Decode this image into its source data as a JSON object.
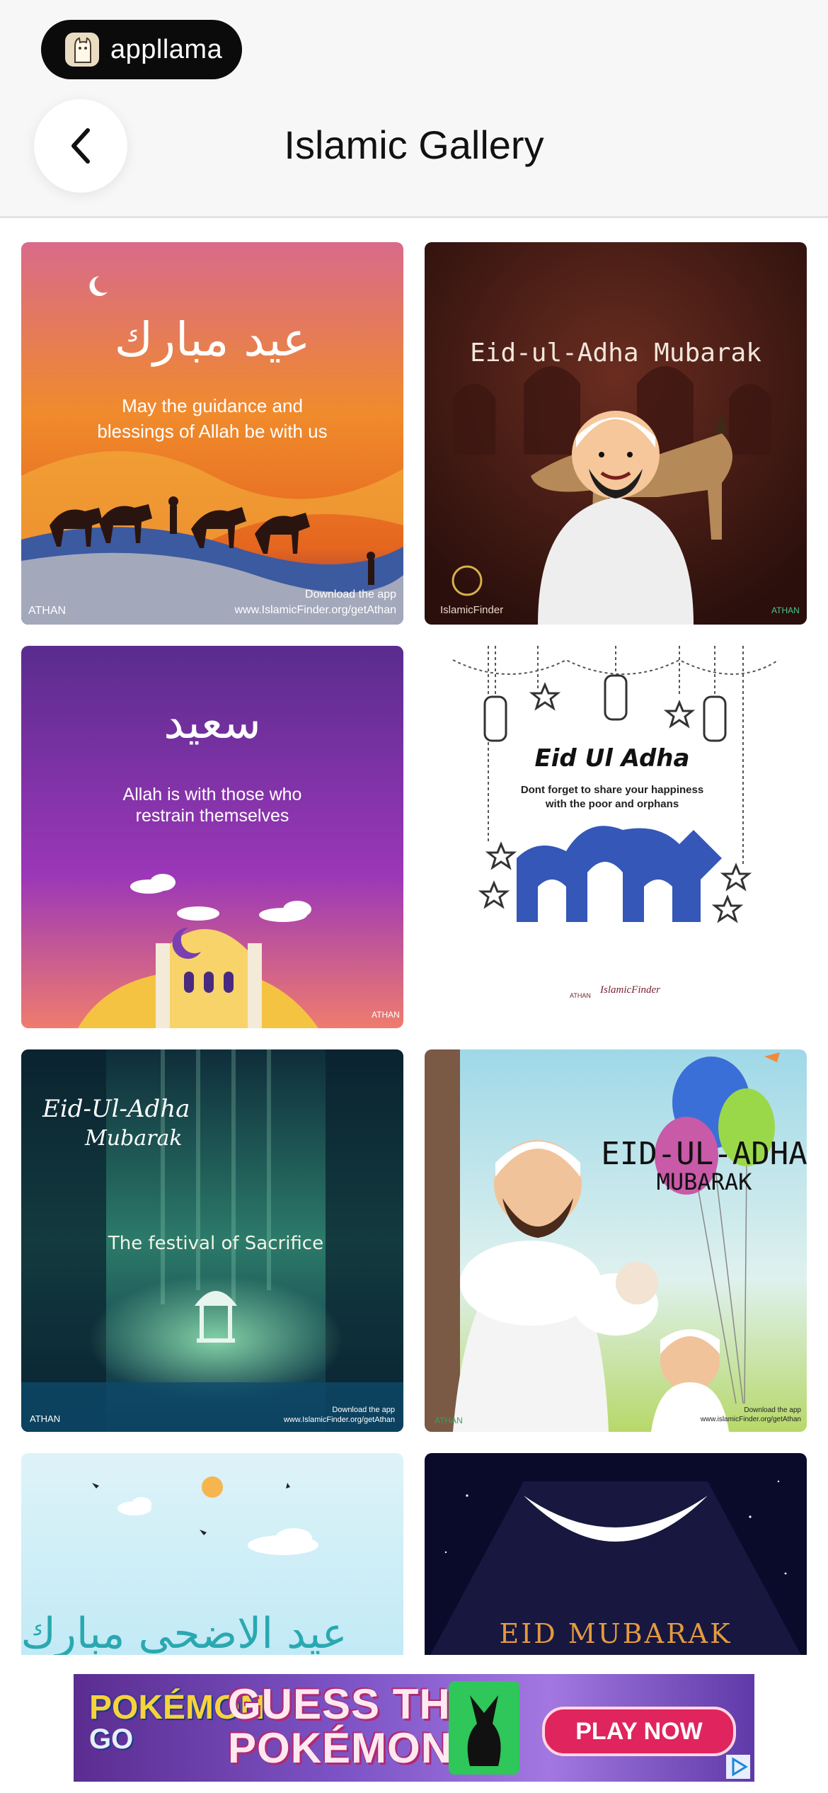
{
  "brand": {
    "name": "appllama"
  },
  "header": {
    "title": "Islamic Gallery",
    "back_icon": "chevron-left-icon"
  },
  "tiles": [
    {
      "lines": [
        "عيد مبارك",
        "May the guidance and",
        "blessings of Allah be with us"
      ],
      "footer_brand": "ATHAN",
      "footer_lines": [
        "Download the app",
        "www.IslamicFinder.org/getAthan"
      ]
    },
    {
      "lines": [
        "Eid-ul-Adha  Mubarak"
      ],
      "footer_brand": "IslamicFinder",
      "footer_brand2": "ATHAN"
    },
    {
      "lines": [
        "سعيد",
        "Allah is with those who",
        "restrain themselves"
      ],
      "footer_brand": "ATHAN"
    },
    {
      "lines": [
        "Eid Ul Adha",
        "Dont forget to share your happiness",
        "with the poor and orphans"
      ],
      "footer_brand": "ATHAN",
      "footer_brand2": "IslamicFinder"
    },
    {
      "lines": [
        "Eid-Ul-Adha",
        "Mubarak",
        "The festival of Sacrifice"
      ],
      "footer_brand": "ATHAN",
      "footer_lines": [
        "Download the app",
        "www.IslamicFinder.org/getAthan"
      ]
    },
    {
      "lines": [
        "EID-UL-ADHA",
        "MUBARAK"
      ],
      "footer_brand": "ATHAN",
      "footer_lines": [
        "Download the app",
        "www.islamicFinder.org/getAthan"
      ]
    },
    {
      "lines": [
        "عيد الاضحى مبارك"
      ]
    },
    {
      "lines": [
        "EID MUBARAK"
      ]
    }
  ],
  "ad": {
    "logo_top": "POKÉMON",
    "logo_bottom": "GO",
    "headline_1": "GUESS THE",
    "headline_2": "POKÉMON",
    "cta": "PLAY NOW"
  },
  "colors": {
    "header_bg": "#f7f7f7",
    "brand_pill": "#0b0b0b",
    "ad_cta": "#e0245e"
  }
}
